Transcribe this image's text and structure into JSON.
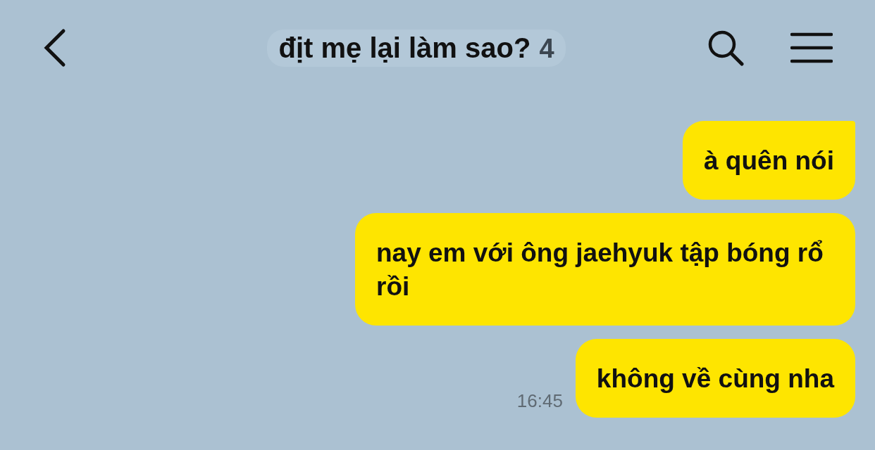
{
  "header": {
    "title": "địt mẹ lại làm sao?",
    "member_count": "4"
  },
  "messages": [
    {
      "text": "à quên nói",
      "tail": true
    },
    {
      "text": "nay em với ông jaehyuk tập bóng rổ rồi",
      "tail": false
    },
    {
      "text": "không về cùng nha",
      "tail": false,
      "time": "16:45"
    }
  ]
}
